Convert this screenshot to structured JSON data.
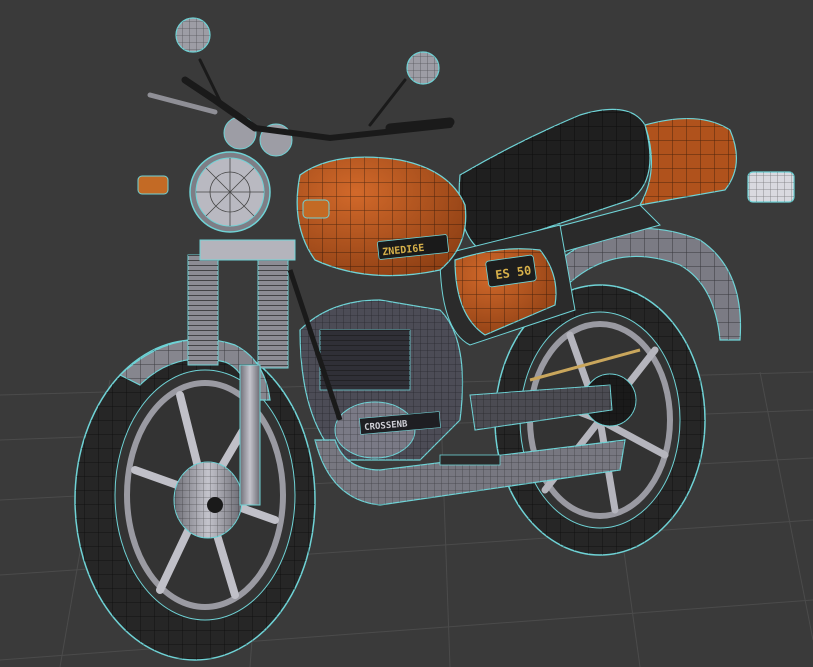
{
  "scene": {
    "background_color": "#3a3a3a",
    "grid_color": "#4a4a4a",
    "wire_color": "#6fd3d6",
    "tank_color": "#b0521c",
    "seat_color": "#1f1f1f",
    "chrome_color": "#8f8f96",
    "tire_color": "#2a2a2a"
  },
  "tank": {
    "brand_text": "ZNEDI6E"
  },
  "side_cover": {
    "model_text": "ES 50"
  },
  "engine": {
    "case_text": "CROSSENB"
  }
}
